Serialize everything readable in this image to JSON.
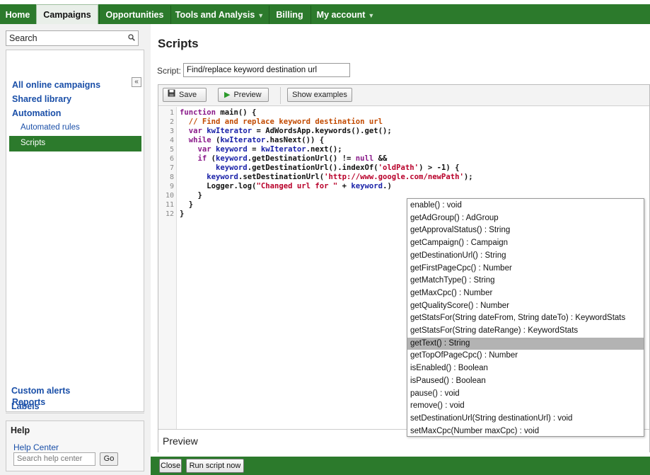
{
  "nav": {
    "tabs": [
      {
        "label": "Home"
      },
      {
        "label": "Campaigns"
      },
      {
        "label": "Opportunities"
      },
      {
        "label": "Tools and Analysis"
      },
      {
        "label": "Billing"
      },
      {
        "label": "My account"
      }
    ]
  },
  "sidebar": {
    "search_label": "Search",
    "collapse_glyph": "«",
    "items": {
      "all_campaigns": "All online campaigns",
      "shared_library": "Shared library",
      "automation": "Automation",
      "automated_rules": "Automated rules",
      "scripts": "Scripts",
      "reports": "Reports",
      "custom_alerts": "Custom alerts",
      "labels": "Labels"
    },
    "help": {
      "title": "Help",
      "link": "Help Center",
      "placeholder": "Search help center",
      "go_label": "Go"
    }
  },
  "main": {
    "title": "Scripts",
    "script_label": "Script:",
    "script_name": "Find/replace keyword destination url",
    "toolbar": {
      "save_label": "Save",
      "preview_label": "Preview",
      "examples_label": "Show examples"
    },
    "line_numbers": [
      "1",
      "2",
      "3",
      "4",
      "5",
      "6",
      "7",
      "8",
      "9",
      "10",
      "11",
      "12"
    ],
    "preview_title": "Preview"
  },
  "autocomplete": {
    "items": [
      "enable() : void",
      "getAdGroup() : AdGroup",
      "getApprovalStatus() : String",
      "getCampaign() : Campaign",
      "getDestinationUrl() : String",
      "getFirstPageCpc() : Number",
      "getMatchType() : String",
      "getMaxCpc() : Number",
      "getQualityScore() : Number",
      "getStatsFor(String dateFrom, String dateTo) : KeywordStats",
      "getStatsFor(String dateRange) : KeywordStats",
      "getText() : String",
      "getTopOfPageCpc() : Number",
      "isEnabled() : Boolean",
      "isPaused() : Boolean",
      "pause() : void",
      "remove() : void",
      "setDestinationUrl(String destinationUrl) : void",
      "setMaxCpc(Number maxCpc) : void"
    ],
    "selected": "getText() : String"
  },
  "bottom": {
    "close_label": "Close",
    "run_label": "Run script now"
  },
  "code": {
    "l1_kw": "function",
    "l1_rest": " main() {",
    "l2": "  // Find and replace keyword destination url",
    "l3_kw": "var",
    "l3_var": "kwIterator",
    "l3_rest": " = AdWordsApp.keywords().get();",
    "l4_kw": "while",
    "l4_a": " (",
    "l4_var": "kwIterator",
    "l4_rest": ".hasNext()) {",
    "l5_kw": "var",
    "l5_var": "keyword",
    "l5_a": " = ",
    "l5_var2": "kwIterator",
    "l5_rest": ".next();",
    "l6_kw": "if",
    "l6_a": " (",
    "l6_var": "keyword",
    "l6_b": ".getDestinationUrl() != ",
    "l6_kw2": "null",
    "l6_rest": " &&",
    "l7_var": "keyword",
    "l7_a": ".getDestinationUrl().indexOf(",
    "l7_str": "'oldPath'",
    "l7_rest": ") > -1) {",
    "l8_var": "keyword",
    "l8_a": ".setDestinationUrl(",
    "l8_str": "'http://www.google.com/newPath'",
    "l8_rest": ");",
    "l9_a": "Logger.log(",
    "l9_str": "\"Changed url for \"",
    "l9_b": " + ",
    "l9_var": "keyword",
    "l9_rest": ".)",
    "l10": "}",
    "l11": "}",
    "l12": "}"
  },
  "colors": {
    "brand_green": "#2c7a2c",
    "link_blue": "#1a4fa8",
    "selection_gray": "#b3b3b3"
  }
}
